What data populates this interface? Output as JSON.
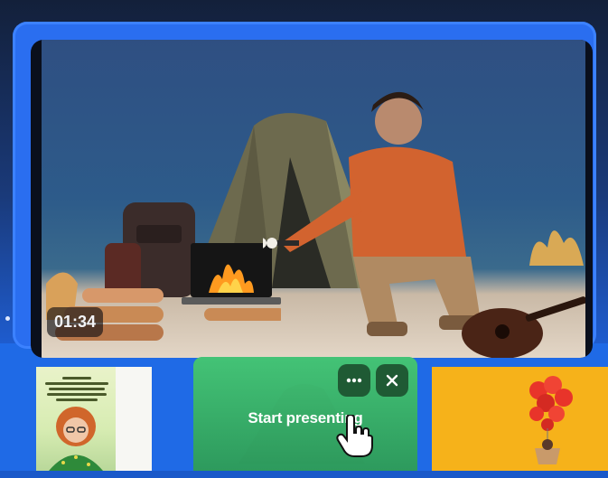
{
  "video": {
    "duration": "01:34"
  },
  "filmstrip": {
    "active_thumbnail": {
      "label": "Start presenting",
      "more_icon": "ellipsis-icon",
      "close_icon": "close-icon"
    }
  },
  "colors": {
    "accent_blue": "#1f6ae6",
    "selected_border": "#3c82ff",
    "active_green": "#2aa66a"
  }
}
